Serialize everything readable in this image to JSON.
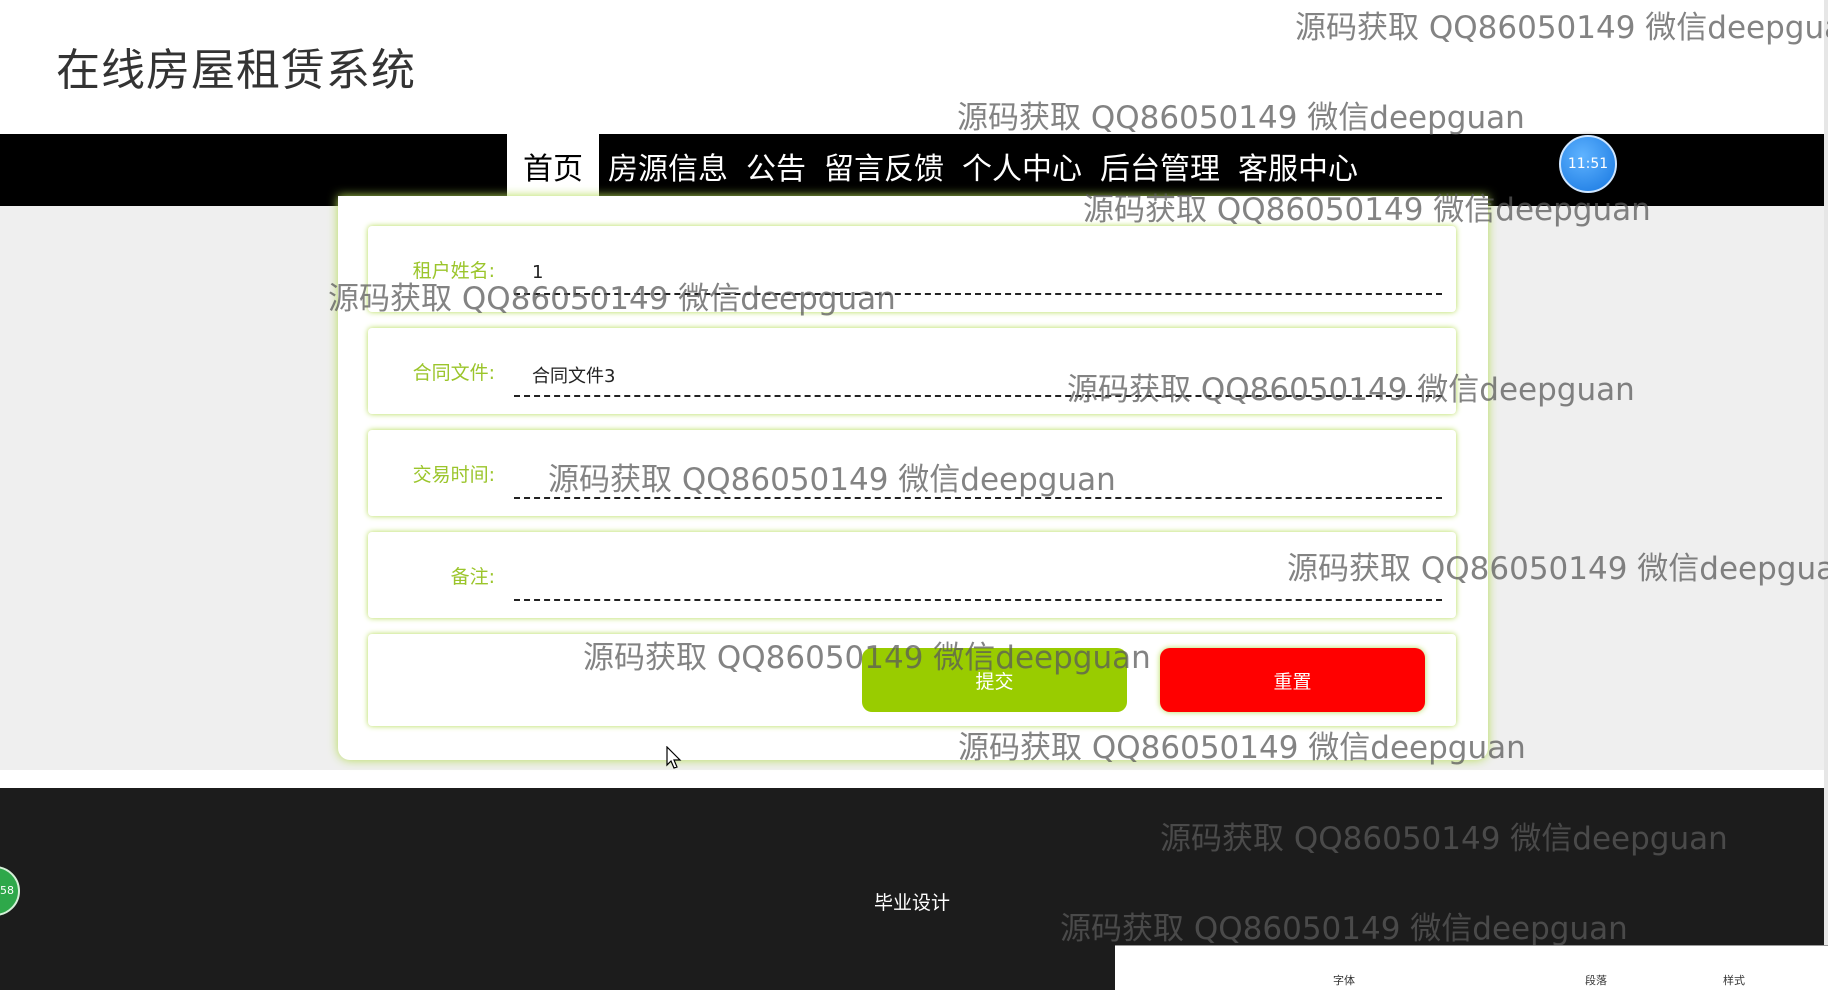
{
  "header": {
    "title": "在线房屋租赁系统"
  },
  "nav": {
    "items": [
      {
        "label": "首页",
        "active": true
      },
      {
        "label": "房源信息",
        "active": false
      },
      {
        "label": "公告",
        "active": false
      },
      {
        "label": "留言反馈",
        "active": false
      },
      {
        "label": "个人中心",
        "active": false
      },
      {
        "label": "后台管理",
        "active": false
      },
      {
        "label": "客服中心",
        "active": false
      }
    ],
    "clock": "11:51"
  },
  "form": {
    "fields": [
      {
        "label": "租户姓名:",
        "value": "1"
      },
      {
        "label": "合同文件:",
        "value": "合同文件3"
      },
      {
        "label": "交易时间:",
        "value": ""
      },
      {
        "label": "备注:",
        "value": ""
      }
    ],
    "submit_label": "提交",
    "reset_label": "重置"
  },
  "footer": {
    "text": "毕业设计",
    "side_badge": "58"
  },
  "watermark": "源码获取 QQ86050149 微信deepguan",
  "taskbar": {
    "labels": [
      "字体",
      "段落",
      "样式"
    ]
  },
  "colors": {
    "accent": "#99cc00",
    "label": "#9bc52b",
    "danger": "#ff0000",
    "nav_bg": "#000000",
    "footer_bg": "#1c1c1c"
  }
}
